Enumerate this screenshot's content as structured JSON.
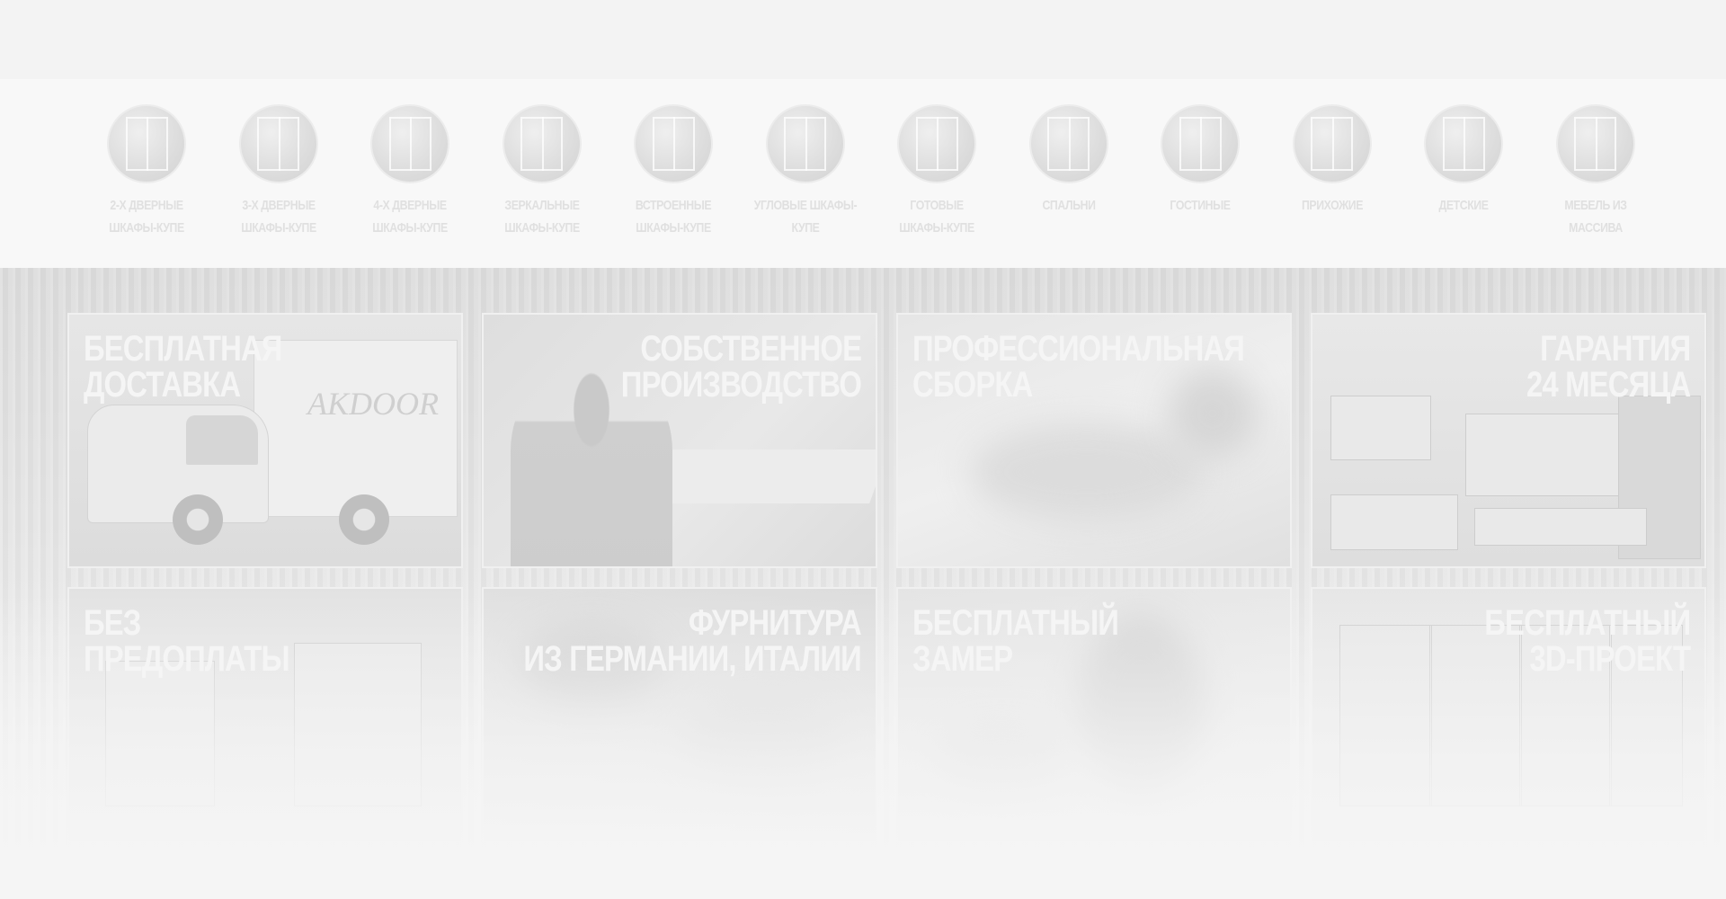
{
  "categories": [
    {
      "label": "2-Х ДВЕРНЫЕ ШКАФЫ-КУПЕ",
      "icon": "wardrobe-2-door-thumb"
    },
    {
      "label": "3-Х ДВЕРНЫЕ ШКАФЫ-КУПЕ",
      "icon": "wardrobe-3-door-thumb"
    },
    {
      "label": "4-Х ДВЕРНЫЕ ШКАФЫ-КУПЕ",
      "icon": "wardrobe-4-door-thumb"
    },
    {
      "label": "ЗЕРКАЛЬНЫЕ ШКАФЫ-КУПЕ",
      "icon": "mirror-wardrobe-thumb"
    },
    {
      "label": "ВСТРОЕННЫЕ ШКАФЫ-КУПЕ",
      "icon": "built-in-wardrobe-thumb"
    },
    {
      "label": "УГЛОВЫЕ ШКАФЫ-КУПЕ",
      "icon": "corner-wardrobe-thumb"
    },
    {
      "label": "ГОТОВЫЕ ШКАФЫ-КУПЕ",
      "icon": "ready-wardrobe-thumb"
    },
    {
      "label": "СПАЛЬНИ",
      "icon": "bedroom-thumb"
    },
    {
      "label": "ГОСТИНЫЕ",
      "icon": "living-room-thumb"
    },
    {
      "label": "ПРИХОЖИЕ",
      "icon": "hallway-thumb"
    },
    {
      "label": "ДЕТСКИЕ",
      "icon": "kids-room-thumb"
    },
    {
      "label": "МЕБЕЛЬ ИЗ МАССИВА",
      "icon": "solid-wood-thumb"
    }
  ],
  "features": [
    {
      "lines": [
        "БЕСПЛАТНАЯ",
        "ДОСТАВКА"
      ],
      "align": "left",
      "image": "delivery-truck-image",
      "truck_logo": "AKDOOR"
    },
    {
      "lines": [
        "СОБСТВЕННОЕ",
        "ПРОИЗВОДСТВО"
      ],
      "align": "right",
      "image": "workshop-image"
    },
    {
      "lines": [
        "ПРОФЕССИОНАЛЬНАЯ",
        "СБОРКА"
      ],
      "align": "left",
      "image": "assembly-image"
    },
    {
      "lines": [
        "ГАРАНТИЯ",
        "24 МЕСЯЦА"
      ],
      "align": "right",
      "image": "furnished-room-image"
    },
    {
      "lines": [
        "БЕЗ",
        "ПРЕДОПЛАТЫ"
      ],
      "align": "left",
      "image": "interior-image"
    },
    {
      "lines": [
        "ФУРНИТУРА",
        "ИЗ ГЕРМАНИИ, ИТАЛИИ"
      ],
      "align": "right",
      "image": "hardware-image"
    },
    {
      "lines": [
        "БЕСПЛАТНЫЙ",
        "ЗАМЕР"
      ],
      "align": "left",
      "image": "measurement-image"
    },
    {
      "lines": [
        "БЕСПЛАТНЫЙ",
        "3D-ПРОЕКТ"
      ],
      "align": "right",
      "image": "3d-project-image"
    }
  ]
}
